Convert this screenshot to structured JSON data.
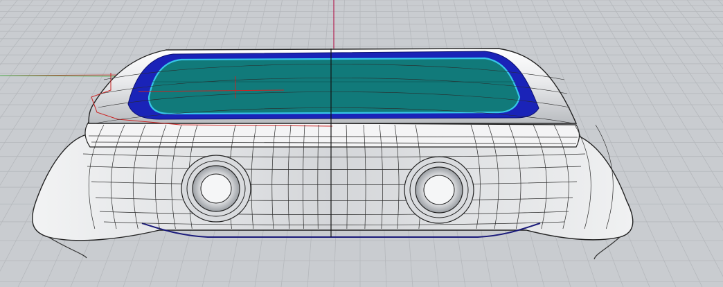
{
  "viewport": {
    "view_mode": "perspective",
    "display_mode": "shaded-with-wireframe",
    "colors": {
      "background": "#c9ccd0",
      "grid_line": "#b5b8bc",
      "axis_x": "#c94a4a",
      "axis_y": "#4caf50",
      "axis_z": "#b0003a",
      "body_shell": "#e8e9eb",
      "wire": "#2a2a2a",
      "bezel_blue": "#1a23b8",
      "screen_teal": "#117a7a",
      "screen_highlight": "#37c6e8",
      "selected_curve": "#cc2222"
    }
  },
  "model": {
    "object": "watch-case",
    "buttons": [
      {
        "name": "side-button-left"
      },
      {
        "name": "side-button-right"
      }
    ]
  }
}
